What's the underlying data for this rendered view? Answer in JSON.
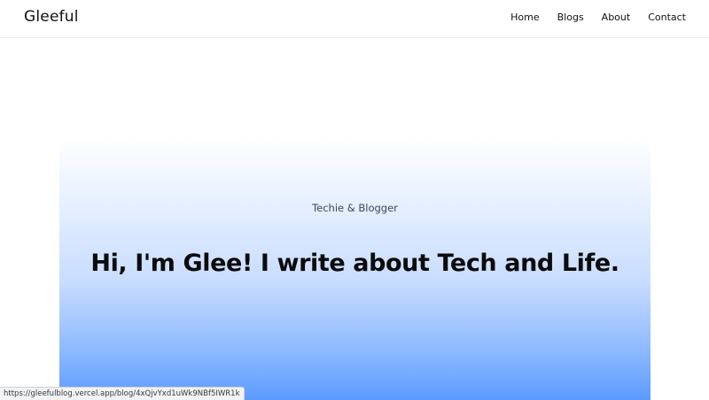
{
  "header": {
    "brand": "Gleeful",
    "nav": [
      {
        "label": "Home"
      },
      {
        "label": "Blogs"
      },
      {
        "label": "About"
      },
      {
        "label": "Contact"
      }
    ]
  },
  "hero": {
    "tagline": "Techie & Blogger",
    "headline": "Hi, I'm Glee! I write about Tech and Life.",
    "gradient_colors": [
      "#ffffff",
      "#c8dcff",
      "#5c9bff"
    ]
  },
  "status_bar": {
    "url": "https://gleefulblog.vercel.app/blog/4xQjvYxd1uWk9NBf5IWR1k"
  }
}
